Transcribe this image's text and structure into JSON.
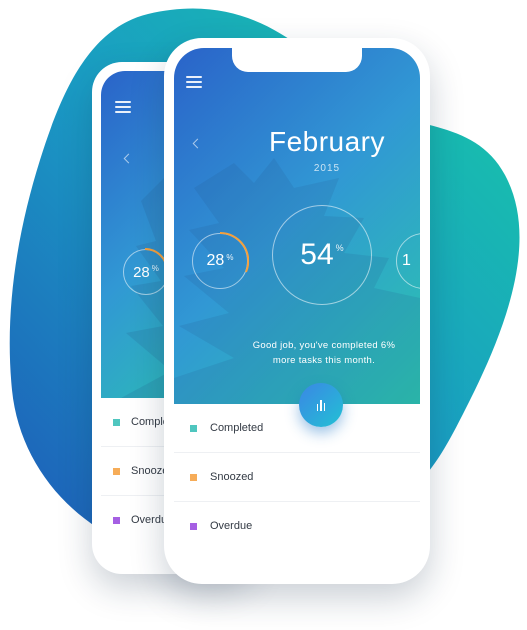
{
  "colors": {
    "completed": "#4fc6bf",
    "snoozed": "#f6ac58",
    "overdue": "#a55fe3",
    "ring_accent": "#f5a03c"
  },
  "back_phone": {
    "menu_icon": "hamburger-menu-icon",
    "prev_icon": "chevron-left-icon",
    "ring": {
      "value": "28",
      "unit": "%"
    },
    "legend": [
      {
        "label": "Completed",
        "color_key": "completed"
      },
      {
        "label": "Snoozed",
        "color_key": "snoozed"
      },
      {
        "label": "Overdue",
        "color_key": "overdue"
      }
    ]
  },
  "front_phone": {
    "menu_icon": "hamburger-menu-icon",
    "prev_icon": "chevron-left-icon",
    "month": "February",
    "year": "2015",
    "rings": {
      "left": {
        "value": "28",
        "unit": "%",
        "progress": 0.28
      },
      "center": {
        "value": "54",
        "unit": "%"
      },
      "right": {
        "value": "1"
      }
    },
    "message_line1": "Good job, you've completed 6%",
    "message_line2": "more tasks this month.",
    "fab_icon": "bar-chart-icon",
    "legend": [
      {
        "label": "Completed",
        "color_key": "completed"
      },
      {
        "label": "Snoozed",
        "color_key": "snoozed"
      },
      {
        "label": "Overdue",
        "color_key": "overdue"
      }
    ]
  }
}
